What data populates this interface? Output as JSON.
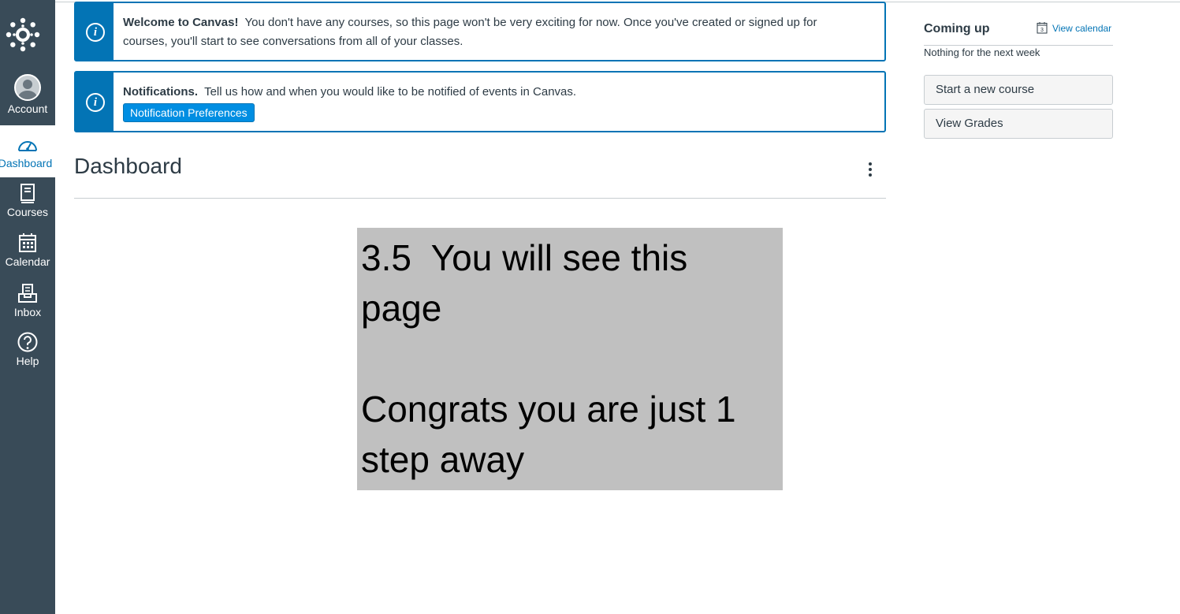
{
  "nav": {
    "items": [
      {
        "label": "Account",
        "icon": "account-avatar-icon"
      },
      {
        "label": "Dashboard",
        "icon": "dashboard-gauge-icon",
        "active": true
      },
      {
        "label": "Courses",
        "icon": "courses-book-icon"
      },
      {
        "label": "Calendar",
        "icon": "calendar-icon"
      },
      {
        "label": "Inbox",
        "icon": "inbox-icon"
      },
      {
        "label": "Help",
        "icon": "help-circle-icon"
      }
    ]
  },
  "alerts": {
    "welcome": {
      "title": "Welcome to Canvas!",
      "message": "You don't have any courses, so this page won't be very exciting for now. Once you've created or signed up for courses, you'll start to see conversations from all of your classes."
    },
    "notifications": {
      "title": "Notifications.",
      "message": "Tell us how and when you would like to be notified of events in Canvas.",
      "button_label": "Notification Preferences"
    }
  },
  "dashboard": {
    "title": "Dashboard"
  },
  "overlay": {
    "line1": "3.5  You will see this page",
    "line2": "Congrats you are just 1 step away"
  },
  "sidebar": {
    "coming_up_title": "Coming up",
    "view_calendar_label": "View calendar",
    "calendar_icon_day": "3",
    "empty_message": "Nothing for the next week",
    "start_course_label": "Start a new course",
    "view_grades_label": "View Grades"
  },
  "colors": {
    "nav_bg": "#394b58",
    "accent": "#0374b5",
    "button_blue": "#008ee2",
    "overlay_bg": "#c0c0c0"
  }
}
